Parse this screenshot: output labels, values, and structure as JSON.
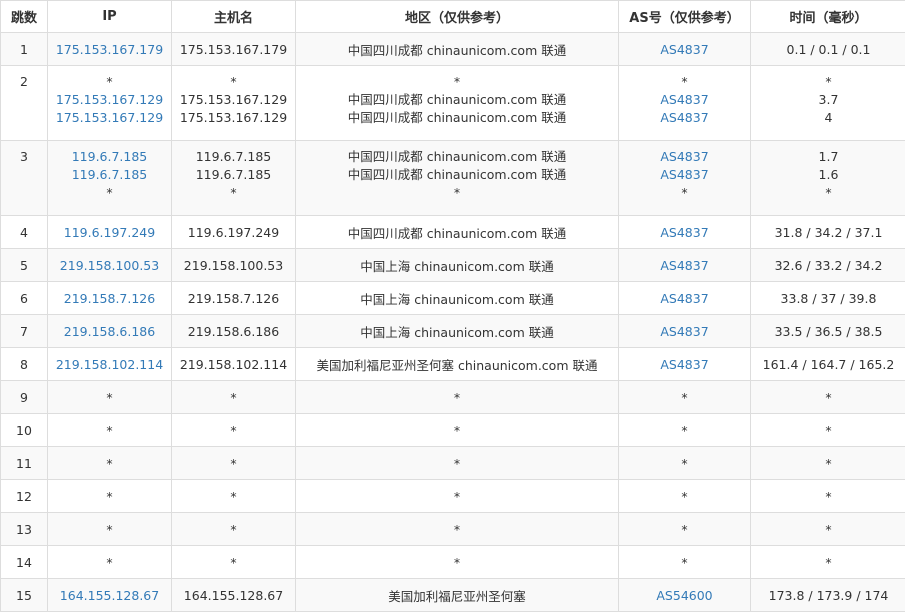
{
  "headers": {
    "hop": "跳数",
    "ip": "IP",
    "host": "主机名",
    "region": "地区（仅供参考）",
    "as": "AS号（仅供参考）",
    "time": "时间（毫秒）"
  },
  "rows": [
    {
      "hop": "1",
      "ip": [
        "175.153.167.179"
      ],
      "host": [
        "175.153.167.179"
      ],
      "region": [
        "中国四川成都 chinaunicom.com 联通"
      ],
      "as": [
        "AS4837"
      ],
      "time": [
        "0.1 / 0.1 / 0.1"
      ]
    },
    {
      "hop": "2",
      "ip": [
        "*",
        "175.153.167.129",
        "175.153.167.129"
      ],
      "host": [
        "*",
        "175.153.167.129",
        "175.153.167.129"
      ],
      "region": [
        "*",
        "中国四川成都 chinaunicom.com 联通",
        "中国四川成都 chinaunicom.com 联通"
      ],
      "as": [
        "*",
        "AS4837",
        "AS4837"
      ],
      "time": [
        "*",
        "3.7",
        "4"
      ]
    },
    {
      "hop": "3",
      "ip": [
        "119.6.7.185",
        "119.6.7.185",
        "*"
      ],
      "host": [
        "119.6.7.185",
        "119.6.7.185",
        "*"
      ],
      "region": [
        "中国四川成都 chinaunicom.com 联通",
        "中国四川成都 chinaunicom.com 联通",
        "*"
      ],
      "as": [
        "AS4837",
        "AS4837",
        "*"
      ],
      "time": [
        "1.7",
        "1.6",
        "*"
      ]
    },
    {
      "hop": "4",
      "ip": [
        "119.6.197.249"
      ],
      "host": [
        "119.6.197.249"
      ],
      "region": [
        "中国四川成都 chinaunicom.com 联通"
      ],
      "as": [
        "AS4837"
      ],
      "time": [
        "31.8 / 34.2 / 37.1"
      ]
    },
    {
      "hop": "5",
      "ip": [
        "219.158.100.53"
      ],
      "host": [
        "219.158.100.53"
      ],
      "region": [
        "中国上海 chinaunicom.com 联通"
      ],
      "as": [
        "AS4837"
      ],
      "time": [
        "32.6 / 33.2 / 34.2"
      ]
    },
    {
      "hop": "6",
      "ip": [
        "219.158.7.126"
      ],
      "host": [
        "219.158.7.126"
      ],
      "region": [
        "中国上海 chinaunicom.com 联通"
      ],
      "as": [
        "AS4837"
      ],
      "time": [
        "33.8 / 37 / 39.8"
      ]
    },
    {
      "hop": "7",
      "ip": [
        "219.158.6.186"
      ],
      "host": [
        "219.158.6.186"
      ],
      "region": [
        "中国上海 chinaunicom.com 联通"
      ],
      "as": [
        "AS4837"
      ],
      "time": [
        "33.5 / 36.5 / 38.5"
      ]
    },
    {
      "hop": "8",
      "ip": [
        "219.158.102.114"
      ],
      "host": [
        "219.158.102.114"
      ],
      "region": [
        "美国加利福尼亚州圣何塞 chinaunicom.com 联通"
      ],
      "as": [
        "AS4837"
      ],
      "time": [
        "161.4 / 164.7 / 165.2"
      ]
    },
    {
      "hop": "9",
      "ip": [
        "*"
      ],
      "host": [
        "*"
      ],
      "region": [
        "*"
      ],
      "as": [
        "*"
      ],
      "time": [
        "*"
      ]
    },
    {
      "hop": "10",
      "ip": [
        "*"
      ],
      "host": [
        "*"
      ],
      "region": [
        "*"
      ],
      "as": [
        "*"
      ],
      "time": [
        "*"
      ]
    },
    {
      "hop": "11",
      "ip": [
        "*"
      ],
      "host": [
        "*"
      ],
      "region": [
        "*"
      ],
      "as": [
        "*"
      ],
      "time": [
        "*"
      ]
    },
    {
      "hop": "12",
      "ip": [
        "*"
      ],
      "host": [
        "*"
      ],
      "region": [
        "*"
      ],
      "as": [
        "*"
      ],
      "time": [
        "*"
      ]
    },
    {
      "hop": "13",
      "ip": [
        "*"
      ],
      "host": [
        "*"
      ],
      "region": [
        "*"
      ],
      "as": [
        "*"
      ],
      "time": [
        "*"
      ]
    },
    {
      "hop": "14",
      "ip": [
        "*"
      ],
      "host": [
        "*"
      ],
      "region": [
        "*"
      ],
      "as": [
        "*"
      ],
      "time": [
        "*"
      ]
    },
    {
      "hop": "15",
      "ip": [
        "164.155.128.67"
      ],
      "host": [
        "164.155.128.67"
      ],
      "region": [
        "美国加利福尼亚州圣何塞"
      ],
      "as": [
        "AS54600"
      ],
      "time": [
        "173.8 / 173.9 / 174"
      ]
    }
  ],
  "colors": {
    "link": "#337ab7",
    "text": "#333333",
    "border": "#dddddd",
    "row_stripe": "#f9f9f9"
  }
}
